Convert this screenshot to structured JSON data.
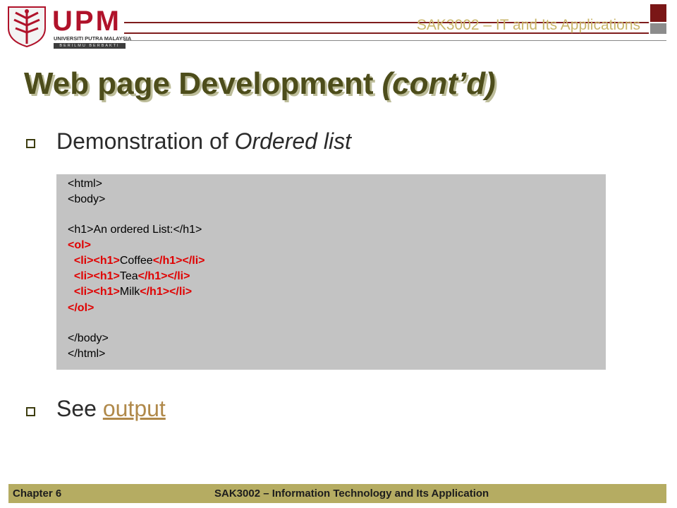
{
  "header": {
    "logo_text": "UPM",
    "logo_subtitle": "UNIVERSITI PUTRA MALAYSIA",
    "logo_motto": "BERILMU BERBAKTI",
    "course_title": "SAK3002 – IT and Its Applications"
  },
  "slide": {
    "title": "Web page Development",
    "title_suffix": "(cont’d)",
    "bullet1_prefix": "Demonstration of ",
    "bullet1_italic": "Ordered list",
    "bullet2_prefix": "See ",
    "bullet2_link": "output"
  },
  "code": {
    "line1": "<html>",
    "line2": "<body>",
    "line3_open": "<h1>",
    "line3_text": "An ordered List:",
    "line3_close": "</h1>",
    "ol_open": "<ol>",
    "li_open": "<li>",
    "h1_open": "<h1>",
    "h1_close": "</h1>",
    "li_close": "</li>",
    "item1": "Coffee",
    "item2": "Tea",
    "item3": "Milk",
    "ol_close": "</ol>",
    "body_close": "</body>",
    "html_close": "</html>"
  },
  "footer": {
    "chapter": "Chapter 6",
    "course": "SAK3002 – Information Technology and Its Application"
  },
  "colors": {
    "accent_red": "#e00000",
    "title": "#4d4d1b",
    "footer_bg": "#b5ac62",
    "code_bg": "#c3c3c3",
    "link": "#b0894a"
  }
}
